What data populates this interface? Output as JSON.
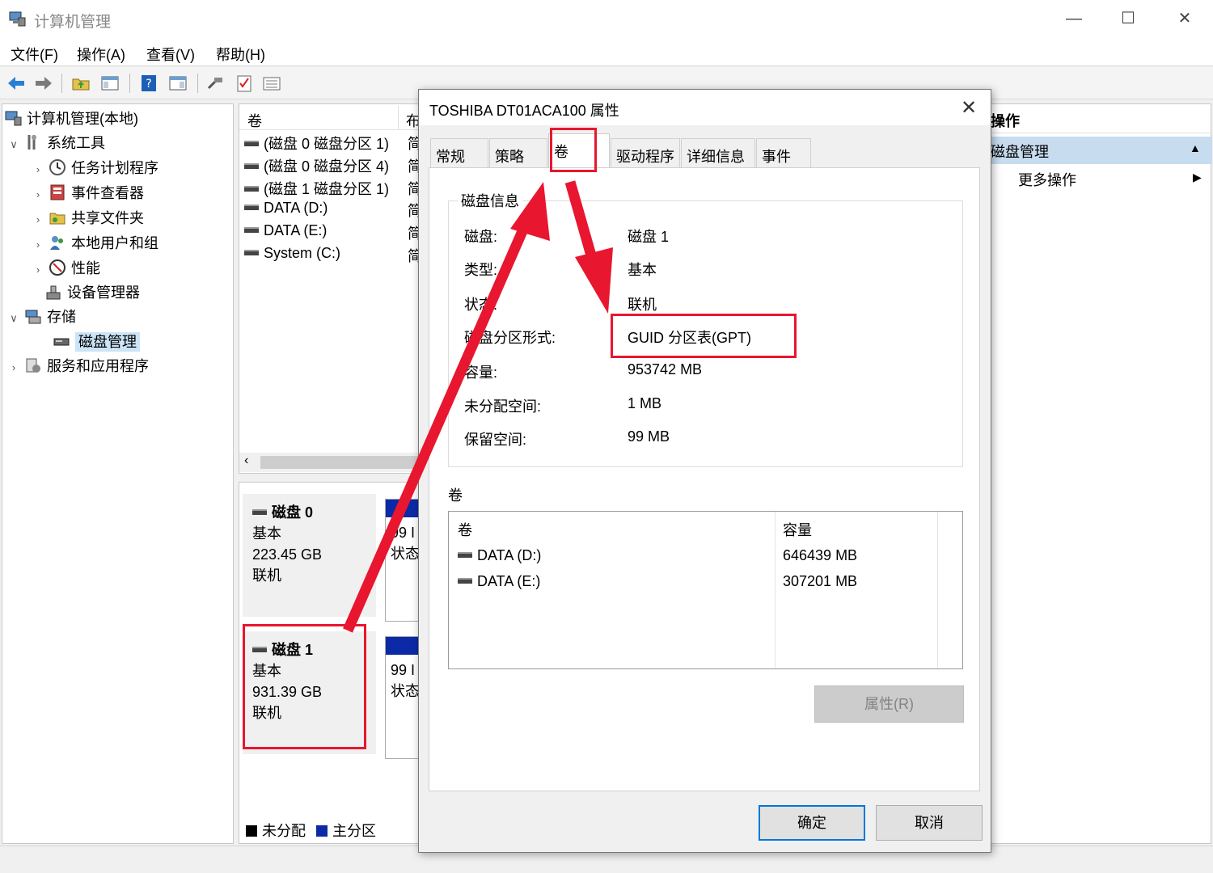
{
  "window": {
    "title": "计算机管理",
    "menu": [
      "文件(F)",
      "操作(A)",
      "查看(V)",
      "帮助(H)"
    ]
  },
  "tree": {
    "root": "计算机管理(本地)",
    "system_tools": "系统工具",
    "task_scheduler": "任务计划程序",
    "event_viewer": "事件查看器",
    "shared_folders": "共享文件夹",
    "local_users": "本地用户和组",
    "performance": "性能",
    "device_manager": "设备管理器",
    "storage": "存储",
    "disk_management": "磁盘管理",
    "services_apps": "服务和应用程序"
  },
  "volume_list": {
    "col_volume": "卷",
    "col_layout": "布",
    "rows": [
      {
        "name": "(磁盘 0 磁盘分区 1)",
        "layout": "简"
      },
      {
        "name": "(磁盘 0 磁盘分区 4)",
        "layout": "简"
      },
      {
        "name": "(磁盘 1 磁盘分区 1)",
        "layout": "简"
      },
      {
        "name": "DATA (D:)",
        "layout": "简"
      },
      {
        "name": "DATA (E:)",
        "layout": "简"
      },
      {
        "name": "System (C:)",
        "layout": "简"
      }
    ]
  },
  "disk_map": {
    "disks": [
      {
        "name": "磁盘 0",
        "type": "基本",
        "size": "223.45 GB",
        "status": "联机",
        "part_size": "99 I",
        "part_status": "状态"
      },
      {
        "name": "磁盘 1",
        "type": "基本",
        "size": "931.39 GB",
        "status": "联机",
        "part_size": "99 I",
        "part_status": "状态"
      }
    ],
    "legend_unallocated": "未分配",
    "legend_primary": "主分区"
  },
  "actions": {
    "header": "操作",
    "group": "磁盘管理",
    "more": "更多操作"
  },
  "dialog": {
    "title": "TOSHIBA DT01ACA100 属性",
    "tabs": [
      "常规",
      "策略",
      "卷",
      "驱动程序",
      "详细信息",
      "事件"
    ],
    "active_tab": "卷",
    "disk_info_title": "磁盘信息",
    "fields": [
      {
        "key": "磁盘:",
        "value": "磁盘 1"
      },
      {
        "key": "类型:",
        "value": "基本"
      },
      {
        "key": "状态:",
        "value": "联机"
      },
      {
        "key": "磁盘分区形式:",
        "value": "GUID 分区表(GPT)"
      },
      {
        "key": "容量:",
        "value": "953742 MB"
      },
      {
        "key": "未分配空间:",
        "value": "1 MB"
      },
      {
        "key": "保留空间:",
        "value": "99 MB"
      }
    ],
    "volumes_title": "卷",
    "volumes_table": {
      "headers": [
        "卷",
        "容量"
      ],
      "rows": [
        {
          "volume": "DATA (D:)",
          "capacity": "646439 MB"
        },
        {
          "volume": "DATA (E:)",
          "capacity": "307201 MB"
        }
      ]
    },
    "properties_button": "属性(R)",
    "ok_button": "确定",
    "cancel_button": "取消"
  },
  "colors": {
    "annotation_red": "#e8162f",
    "primary_partition_blue": "#0c2aa6",
    "selection_blue": "#cce4f7",
    "focus_blue": "#0078d7"
  }
}
